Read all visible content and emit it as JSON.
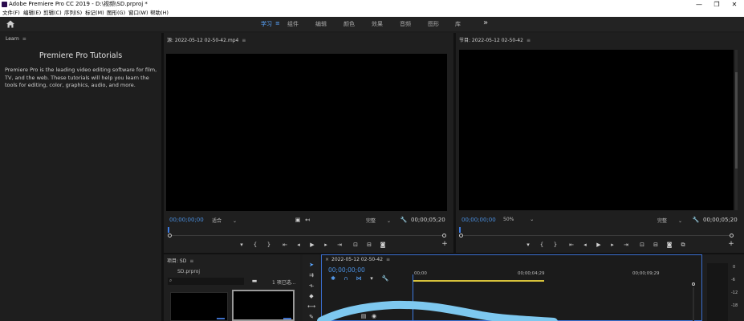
{
  "window": {
    "title": "Adobe Premiere Pro CC 2019 - D:\\视频\\SD.prproj *",
    "minimize": "—",
    "maximize": "❐",
    "close": "✕"
  },
  "menu": [
    "文件(F)",
    "编辑(E)",
    "剪辑(C)",
    "序列(S)",
    "标记(M)",
    "图形(G)",
    "窗口(W)",
    "帮助(H)"
  ],
  "workspaces": {
    "tabs": [
      {
        "label": "学习",
        "active": true
      },
      {
        "label": "组件",
        "active": false
      },
      {
        "label": "编辑",
        "active": false
      },
      {
        "label": "颜色",
        "active": false
      },
      {
        "label": "效果",
        "active": false
      },
      {
        "label": "音频",
        "active": false
      },
      {
        "label": "图形",
        "active": false
      },
      {
        "label": "库",
        "active": false
      }
    ],
    "more": "»",
    "menu_glyph": "≡"
  },
  "learn": {
    "panel_label": "Learn",
    "title": "Premiere Pro Tutorials",
    "description": "Premiere Pro is the leading video editing software for film, TV, and the web. These tutorials will help you learn the tools for editing, color, graphics, audio, and more."
  },
  "source_monitor": {
    "title": "源: 2022-05-12 02-50-42.mp4",
    "timecode": "00;00;00;00",
    "fit": "适合",
    "resolution": "完整",
    "duration": "00;00;05;20"
  },
  "program_monitor": {
    "title": "节目: 2022-05-12 02-50-42",
    "timecode": "00;00;00;00",
    "zoom": "50%",
    "resolution": "完整",
    "duration": "00;00;05;20"
  },
  "project": {
    "title": "项目: SD",
    "file": "SD.prproj",
    "item_count": "1 项已选..."
  },
  "timeline": {
    "sequence": "2022-05-12 02-50-42",
    "timecode": "00;00;00;00",
    "ruler_labels": [
      "00;00",
      "00;00;04;29",
      "00;00;09;29"
    ]
  },
  "audio_meter": {
    "labels": [
      "0",
      "-6",
      "-12",
      "-18"
    ]
  },
  "colors": {
    "accent": "#4a8fe0",
    "annotation_stroke": "#7ec8ef",
    "playhead": "#3d7be0",
    "work_area": "#d7c23b"
  }
}
